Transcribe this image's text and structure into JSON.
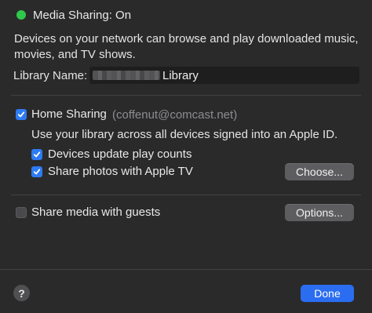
{
  "status": {
    "text": "Media Sharing: On",
    "indicator_color": "#2fc84a"
  },
  "description": "Devices on your network can browse and play downloaded music, movies, and TV shows.",
  "library": {
    "label": "Library Name:",
    "value": "Library"
  },
  "home_sharing": {
    "label": "Home Sharing",
    "checked": true,
    "account": "(coffenut@comcast.net)",
    "description": "Use your library across all devices signed into an Apple ID.",
    "options": [
      {
        "label": "Devices update play counts",
        "checked": true
      },
      {
        "label": "Share photos with Apple TV",
        "checked": true
      }
    ],
    "choose_button": "Choose..."
  },
  "guests": {
    "label": "Share media with guests",
    "checked": false,
    "options_button": "Options..."
  },
  "footer": {
    "help_glyph": "?",
    "done_button": "Done"
  },
  "colors": {
    "accent": "#2e7bf4",
    "done_button": "#2a6df0",
    "background": "#2a2a2b"
  },
  "icons": [
    "checkmark-icon",
    "help-icon"
  ]
}
